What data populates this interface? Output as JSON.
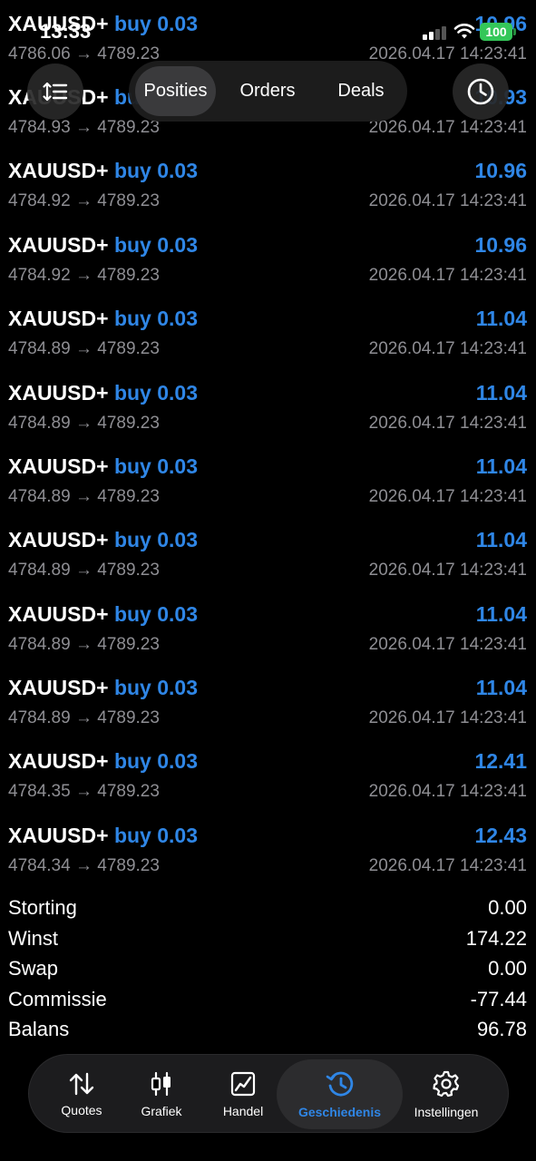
{
  "status_bar": {
    "time": "13:33",
    "battery": "100"
  },
  "segments": [
    {
      "label": "Posities",
      "active": true
    },
    {
      "label": "Orders",
      "active": false
    },
    {
      "label": "Deals",
      "active": false
    }
  ],
  "deals": [
    {
      "symbol": "XAUUSD+",
      "side": "buy 0.03",
      "profit": "10.96",
      "open": "4786.06",
      "close": "4789.23",
      "arrow": "→",
      "time": "2026.04.17 14:23:41"
    },
    {
      "symbol": "XAUUSD+",
      "side": "buy 0.03",
      "profit": "10.93",
      "open": "4784.93",
      "close": "4789.23",
      "arrow": "→",
      "time": "2026.04.17 14:23:41"
    },
    {
      "symbol": "XAUUSD+",
      "side": "buy 0.03",
      "profit": "10.96",
      "open": "4784.92",
      "close": "4789.23",
      "arrow": "→",
      "time": "2026.04.17 14:23:41"
    },
    {
      "symbol": "XAUUSD+",
      "side": "buy 0.03",
      "profit": "10.96",
      "open": "4784.92",
      "close": "4789.23",
      "arrow": "→",
      "time": "2026.04.17 14:23:41"
    },
    {
      "symbol": "XAUUSD+",
      "side": "buy 0.03",
      "profit": "11.04",
      "open": "4784.89",
      "close": "4789.23",
      "arrow": "→",
      "time": "2026.04.17 14:23:41"
    },
    {
      "symbol": "XAUUSD+",
      "side": "buy 0.03",
      "profit": "11.04",
      "open": "4784.89",
      "close": "4789.23",
      "arrow": "→",
      "time": "2026.04.17 14:23:41"
    },
    {
      "symbol": "XAUUSD+",
      "side": "buy 0.03",
      "profit": "11.04",
      "open": "4784.89",
      "close": "4789.23",
      "arrow": "→",
      "time": "2026.04.17 14:23:41"
    },
    {
      "symbol": "XAUUSD+",
      "side": "buy 0.03",
      "profit": "11.04",
      "open": "4784.89",
      "close": "4789.23",
      "arrow": "→",
      "time": "2026.04.17 14:23:41"
    },
    {
      "symbol": "XAUUSD+",
      "side": "buy 0.03",
      "profit": "11.04",
      "open": "4784.89",
      "close": "4789.23",
      "arrow": "→",
      "time": "2026.04.17 14:23:41"
    },
    {
      "symbol": "XAUUSD+",
      "side": "buy 0.03",
      "profit": "11.04",
      "open": "4784.89",
      "close": "4789.23",
      "arrow": "→",
      "time": "2026.04.17 14:23:41"
    },
    {
      "symbol": "XAUUSD+",
      "side": "buy 0.03",
      "profit": "12.41",
      "open": "4784.35",
      "close": "4789.23",
      "arrow": "→",
      "time": "2026.04.17 14:23:41"
    },
    {
      "symbol": "XAUUSD+",
      "side": "buy 0.03",
      "profit": "12.43",
      "open": "4784.34",
      "close": "4789.23",
      "arrow": "→",
      "time": "2026.04.17 14:23:41"
    }
  ],
  "summary": [
    {
      "label": "Storting",
      "value": "0.00"
    },
    {
      "label": "Winst",
      "value": "174.22"
    },
    {
      "label": "Swap",
      "value": "0.00"
    },
    {
      "label": "Commissie",
      "value": "-77.44"
    },
    {
      "label": "Balans",
      "value": "96.78"
    }
  ],
  "tabs": [
    {
      "label": "Quotes",
      "icon": "quotes-icon",
      "active": false
    },
    {
      "label": "Grafiek",
      "icon": "chart-candles-icon",
      "active": false
    },
    {
      "label": "Handel",
      "icon": "trade-chart-icon",
      "active": false
    },
    {
      "label": "Geschiedenis",
      "icon": "history-icon",
      "active": true
    },
    {
      "label": "Instellingen",
      "icon": "gear-icon",
      "active": false
    }
  ],
  "colors": {
    "accent": "#2f86e6",
    "secondary_text": "#8e8e93",
    "battery": "#34c759"
  }
}
